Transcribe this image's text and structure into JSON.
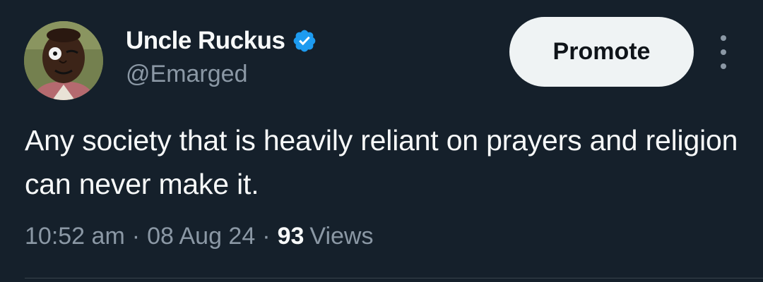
{
  "tweet": {
    "author": {
      "display_name": "Uncle Ruckus",
      "handle": "@Emarged",
      "verified": true,
      "verified_icon": "verified-badge-icon",
      "avatar": "cartoon-portrait"
    },
    "promote_label": "Promote",
    "more_icon": "more-vertical-icon",
    "text": "Any society that is heavily reliant on prayers and religion can never make it.",
    "time": "10:52 am",
    "separator": "·",
    "date": "08 Aug 24",
    "views_count": "93",
    "views_label": "Views"
  },
  "colors": {
    "background": "#15202b",
    "primary_text": "#f7f9f9",
    "secondary_text": "#8b98a5",
    "verified_blue": "#1d9bf0",
    "button_bg": "#eff3f4",
    "button_text": "#0f1419"
  }
}
